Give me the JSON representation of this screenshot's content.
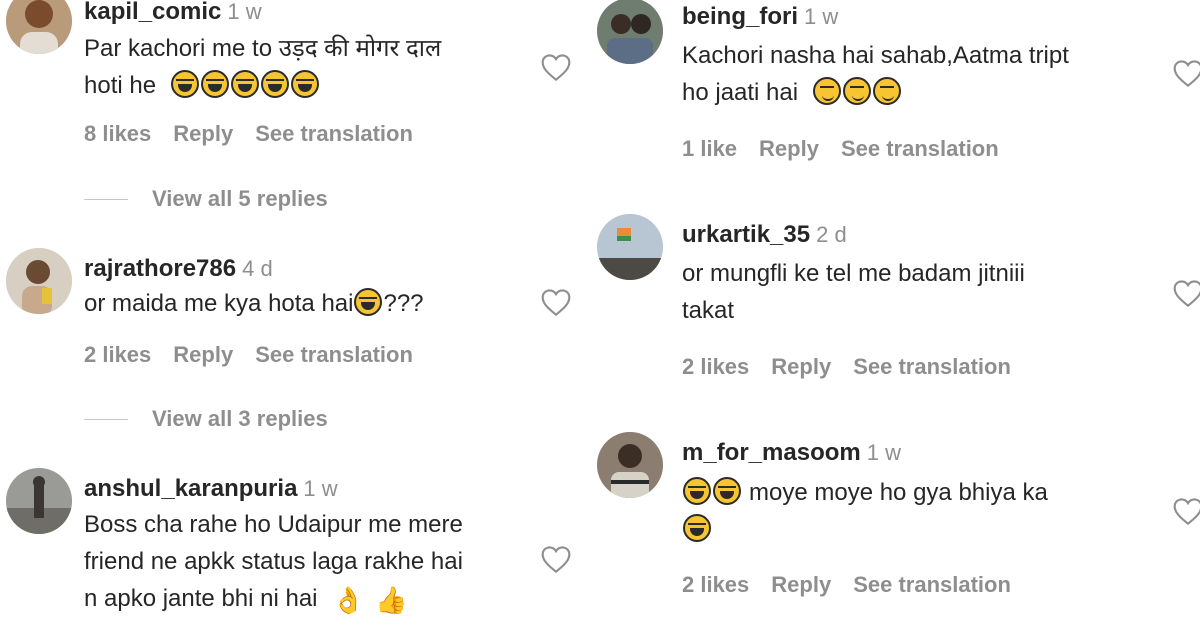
{
  "comments": [
    {
      "username": "kapil_comic",
      "age": "1 w",
      "text_lines": [
        "Par kachori me to उड़द की मोगर दाल",
        "hoti he"
      ],
      "emojis": [
        "laugh",
        "laugh",
        "laugh",
        "laugh",
        "laugh"
      ],
      "likes": "8 likes",
      "reply": "Reply",
      "translate": "See translation",
      "view_replies": "View all 5 replies"
    },
    {
      "username": "rajrathore786",
      "age": "4 d",
      "text_lines": [
        "or maida me kya hota hai",
        "???"
      ],
      "likes": "2 likes",
      "reply": "Reply",
      "translate": "See translation",
      "view_replies": "View all 3 replies"
    },
    {
      "username": "anshul_karanpuria",
      "age": "1 w",
      "text_lines": [
        "Boss cha rahe ho Udaipur me mere",
        "friend ne apkk status laga rakhe hai",
        "n apko jante bhi ni hai"
      ],
      "emojis": [
        "ok-hand",
        "thumbs-up"
      ]
    },
    {
      "username": "being_fori",
      "age": "1 w",
      "text_lines": [
        "Kachori nasha hai sahab,Aatma tript",
        "ho jaati hai"
      ],
      "emojis": [
        "yum",
        "yum",
        "yum"
      ],
      "likes": "1 like",
      "reply": "Reply",
      "translate": "See translation"
    },
    {
      "username": "urkartik_35",
      "age": "2 d",
      "text_lines": [
        "or mungfli ke tel me badam jitniii",
        "takat"
      ],
      "likes": "2 likes",
      "reply": "Reply",
      "translate": "See translation"
    },
    {
      "username": "m_for_masoom",
      "age": "1 w",
      "text_lines": [
        "moye moye ho gya bhiya ka"
      ],
      "emojis": [
        "laugh",
        "laugh",
        "laugh"
      ],
      "likes": "2 likes",
      "reply": "Reply",
      "translate": "See translation"
    }
  ],
  "icons": {
    "heart": "heart-outline-icon",
    "laugh": "face-with-tears-of-joy-emoji",
    "yum": "face-savoring-food-emoji",
    "ok_hand": "ok-hand-emoji",
    "thumbs_up": "thumbs-up-emoji"
  },
  "colors": {
    "text": "#262626",
    "secondary": "#8e8e8e",
    "emoji_yellow": "#f7c531"
  }
}
